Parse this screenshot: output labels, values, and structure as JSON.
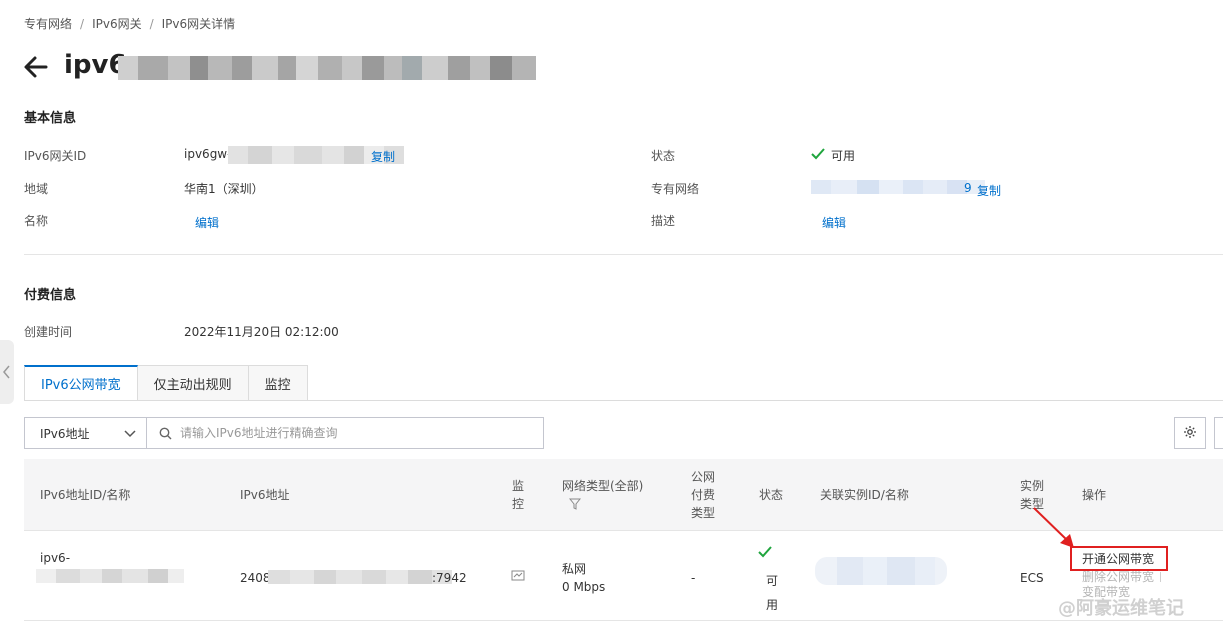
{
  "breadcrumb": [
    "专有网络",
    "IPv6网关",
    "IPv6网关详情"
  ],
  "title": "ipv6",
  "basic_info": {
    "section_title": "基本信息",
    "gateway_id": {
      "label": "IPv6网关ID",
      "value": "ipv6gw-",
      "copy_label": "复制"
    },
    "region": {
      "label": "地域",
      "value": "华南1（深圳）"
    },
    "name": {
      "label": "名称",
      "edit_label": "编辑"
    },
    "status": {
      "label": "状态",
      "value": "可用"
    },
    "vpc": {
      "label": "专有网络",
      "value": "9",
      "copy_label": "复制"
    },
    "description": {
      "label": "描述",
      "edit_label": "编辑"
    }
  },
  "billing_info": {
    "section_title": "付费信息",
    "created_at": {
      "label": "创建时间",
      "value": "2022年11月20日 02:12:00"
    }
  },
  "tabs": [
    {
      "label": "IPv6公网带宽",
      "active": true
    },
    {
      "label": "仅主动出规则",
      "active": false
    },
    {
      "label": "监控",
      "active": false
    }
  ],
  "filter": {
    "field": "IPv6地址",
    "placeholder": "请输入IPv6地址进行精确查询"
  },
  "table": {
    "headers": {
      "id_name": "IPv6地址ID/名称",
      "address": "IPv6地址",
      "monitor": "监控",
      "network_type": "网络类型(全部)",
      "billing_type": "公网付费类型",
      "status": "状态",
      "instance": "关联实例ID/名称",
      "instance_type": "实例类型",
      "actions": "操作"
    },
    "rows": [
      {
        "id_prefix": "ipv6-",
        "address_prefix": "2408",
        "address_suffix": ":7942",
        "network_type": "私网",
        "bandwidth": "0 Mbps",
        "billing_type": "-",
        "status": "可用",
        "instance_type": "ECS",
        "actions": [
          "开通公网带宽",
          "删除公网带宽",
          "变配带宽"
        ]
      }
    ]
  },
  "watermark": "@阿豪运维笔记",
  "colors": {
    "link": "#0070cc",
    "success": "#1fa53d",
    "annotation": "#e02020",
    "header_bg": "#f5f5f6"
  }
}
